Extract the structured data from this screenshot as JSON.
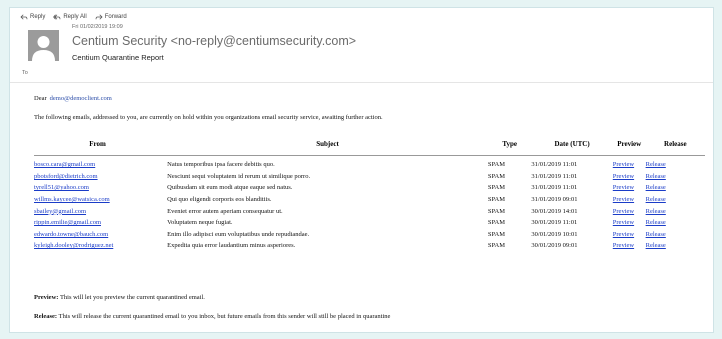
{
  "toolbar": {
    "reply": "Reply",
    "reply_all": "Reply All",
    "forward": "Forward"
  },
  "header": {
    "date": "Fri 01/02/2019 19:09",
    "sender": "Centium Security <no-reply@centiumsecurity.com>",
    "subject": "Centium Quarantine Report",
    "to_label": "To"
  },
  "body": {
    "greeting": "Dear",
    "recipient": "demo@democlient.com",
    "intro": "The following emails, addressed to you, are currently on hold within you organizations email security service, awaiting further action."
  },
  "table": {
    "headers": {
      "from": "From",
      "subject": "Subject",
      "type": "Type",
      "date": "Date (UTC)",
      "preview": "Preview",
      "release": "Release"
    },
    "rows": [
      {
        "from": "bosco.cara@gmail.com",
        "subject": "Natus temporibus ipsa facere debitis quo.",
        "type": "SPAM",
        "date": "31/01/2019 11:01",
        "preview": "Preview",
        "release": "Release"
      },
      {
        "from": "pbotsford@dietrich.com",
        "subject": "Nesciunt sequi voluptatem id rerum ut similique porro.",
        "type": "SPAM",
        "date": "31/01/2019 11:01",
        "preview": "Preview",
        "release": "Release"
      },
      {
        "from": "tyrell51@yahoo.com",
        "subject": "Quibusdam sit eum modi atque eaque sed natus.",
        "type": "SPAM",
        "date": "31/01/2019 11:01",
        "preview": "Preview",
        "release": "Release"
      },
      {
        "from": "willms.kaycee@watsica.com",
        "subject": "Qui quo eligendi corporis eos blanditiis.",
        "type": "SPAM",
        "date": "31/01/2019 09:01",
        "preview": "Preview",
        "release": "Release"
      },
      {
        "from": "sbailey@gmail.com",
        "subject": "Eveniet error autem aperiam consequatur ut.",
        "type": "SPAM",
        "date": "30/01/2019 14:01",
        "preview": "Preview",
        "release": "Release"
      },
      {
        "from": "rippin.emilie@gmail.com",
        "subject": "Voluptatem neque fugiat.",
        "type": "SPAM",
        "date": "30/01/2019 11:01",
        "preview": "Preview",
        "release": "Release"
      },
      {
        "from": "edwardo.towne@bauch.com",
        "subject": "Enim illo adipisci eum voluptatibus unde repudiandae.",
        "type": "SPAM",
        "date": "30/01/2019 10:01",
        "preview": "Preview",
        "release": "Release"
      },
      {
        "from": "kyleigh.dooley@rodriguez.net",
        "subject": "Expedita quia error laudantium minus asperiores.",
        "type": "SPAM",
        "date": "30/01/2019 09:01",
        "preview": "Preview",
        "release": "Release"
      }
    ]
  },
  "footer": {
    "preview_label": "Preview:",
    "preview_text": "This will let you preview the current quarantined email.",
    "release_label": "Release:",
    "release_text": "This will release the current quarantined email to you inbox, but future emails from this sender will still be placed in quarantine"
  },
  "colors": {
    "page_bg": "#e6f4f4",
    "link": "#1a3cc8",
    "avatar": "#9b9b9b"
  },
  "icons": [
    "reply-icon",
    "reply-all-icon",
    "forward-icon",
    "avatar-person-icon"
  ]
}
